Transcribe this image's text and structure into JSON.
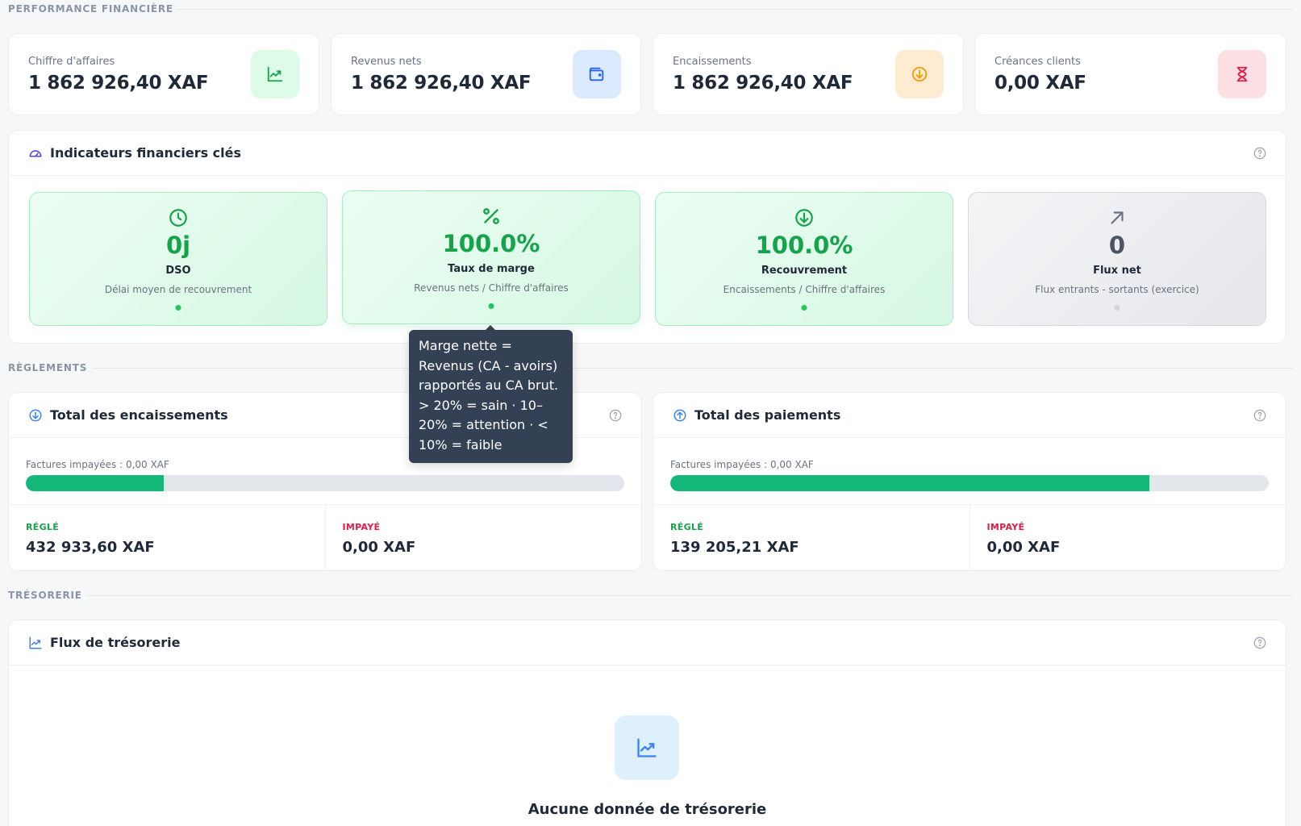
{
  "sections": {
    "performance": "PERFORMANCE FINANCIÈRE",
    "reglements": "RÈGLEMENTS",
    "tresorerie": "TRÉSORERIE"
  },
  "kpis": [
    {
      "label": "Chiffre d'affaires",
      "value": "1 862 926,40 XAF",
      "icon": "chart-line-icon",
      "color": "#16a34a"
    },
    {
      "label": "Revenus nets",
      "value": "1 862 926,40 XAF",
      "icon": "wallet-icon",
      "color": "#2563eb"
    },
    {
      "label": "Encaissements",
      "value": "1 862 926,40 XAF",
      "icon": "arrow-down-circle-icon",
      "color": "#f59e0b"
    },
    {
      "label": "Créances clients",
      "value": "0,00 XAF",
      "icon": "hourglass-icon",
      "color": "#e11d48"
    }
  ],
  "indicators": {
    "title": "Indicateurs financiers clés",
    "tiles": [
      {
        "value": "0j",
        "name": "DSO",
        "desc": "Délai moyen de recouvrement",
        "icon": "clock-icon",
        "status": "green"
      },
      {
        "value": "100.0%",
        "name": "Taux de marge",
        "desc": "Revenus nets / Chiffre d'affaires",
        "icon": "percent-icon",
        "status": "green"
      },
      {
        "value": "100.0%",
        "name": "Recouvrement",
        "desc": "Encaissements / Chiffre d'affaires",
        "icon": "arrow-down-circle-icon",
        "status": "green"
      },
      {
        "value": "0",
        "name": "Flux net",
        "desc": "Flux entrants - sortants (exercice)",
        "icon": "arrow-up-right-icon",
        "status": "gray"
      }
    ]
  },
  "tooltip": {
    "text": "Marge nette = Revenus (CA - avoirs) rapportés au CA brut. > 20% = sain · 10–20% = attention · < 10% = faible"
  },
  "encaissements": {
    "title": "Total des encaissements",
    "unpaid": "Factures impayées : 0,00 XAF",
    "progress": 0.23,
    "paid_label": "RÉGLÉ",
    "paid_value": "432 933,60 XAF",
    "unpaid_label": "IMPAYÉ",
    "unpaid_value": "0,00 XAF"
  },
  "paiements": {
    "title": "Total des paiements",
    "unpaid": "Factures impayées : 0,00 XAF",
    "progress": 0.8,
    "paid_label": "RÉGLÉ",
    "paid_value": "139 205,21 XAF",
    "unpaid_label": "IMPAYÉ",
    "unpaid_value": "0,00 XAF"
  },
  "tresorerie": {
    "title": "Flux de trésorerie",
    "empty": "Aucune donnée de trésorerie"
  },
  "colors": {
    "green": "#16a34a",
    "paid": "#16a34a",
    "unpaid": "#e11d48",
    "bar": "#13b777",
    "blue": "#3b82f6"
  }
}
